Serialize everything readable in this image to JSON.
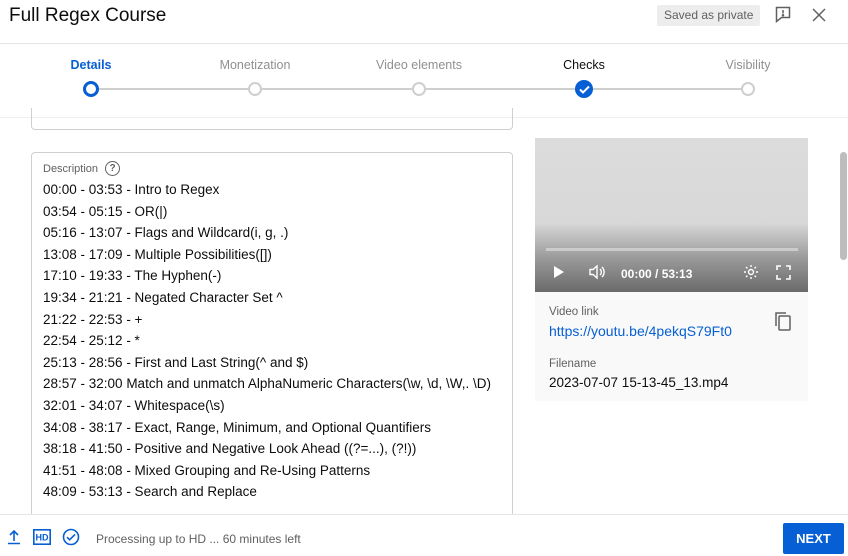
{
  "header": {
    "title": "Full Regex Course",
    "saved_badge": "Saved as private"
  },
  "stepper": {
    "steps": [
      {
        "label": "Details",
        "state": "active"
      },
      {
        "label": "Monetization",
        "state": "pending"
      },
      {
        "label": "Video elements",
        "state": "pending"
      },
      {
        "label": "Checks",
        "state": "checked"
      },
      {
        "label": "Visibility",
        "state": "pending"
      }
    ]
  },
  "description": {
    "label": "Description",
    "lines": [
      "00:00 - 03:53 - Intro to Regex",
      "03:54 - 05:15 - OR(|)",
      "05:16 - 13:07 - Flags and Wildcard(i, g, .)",
      "13:08 - 17:09 - Multiple Possibilities([])",
      "17:10 - 19:33 - The Hyphen(-)",
      "19:34 - 21:21 - Negated Character Set ^",
      "21:22 - 22:53 - +",
      "22:54 - 25:12 - *",
      "25:13 - 28:56 - First and Last String(^ and $)",
      "28:57 - 32:00 Match and unmatch AlphaNumeric Characters(\\w, \\d, \\W,. \\D)",
      "32:01 - 34:07 - Whitespace(\\s)",
      "34:08 - 38:17 - Exact, Range, Minimum, and Optional Quantifiers",
      "38:18 - 41:50 - Positive and Negative Look Ahead ((?=...), (?!))",
      "41:51 - 48:08 - Mixed Grouping and Re-Using Patterns",
      "48:09 - 53:13 - Search and Replace"
    ]
  },
  "player": {
    "time": "00:00 / 53:13",
    "progress": 0
  },
  "video_info": {
    "link_label": "Video link",
    "link_url": "https://youtu.be/4pekqS79Ft0",
    "filename_label": "Filename",
    "filename": "2023-07-07 15-13-45_13.mp4"
  },
  "footer": {
    "status": "Processing up to HD ... 60 minutes left",
    "hd_badge": "HD",
    "next_label": "NEXT"
  },
  "colors": {
    "accent": "#065fd4",
    "text": "#0d0d0d",
    "muted": "#606060"
  }
}
